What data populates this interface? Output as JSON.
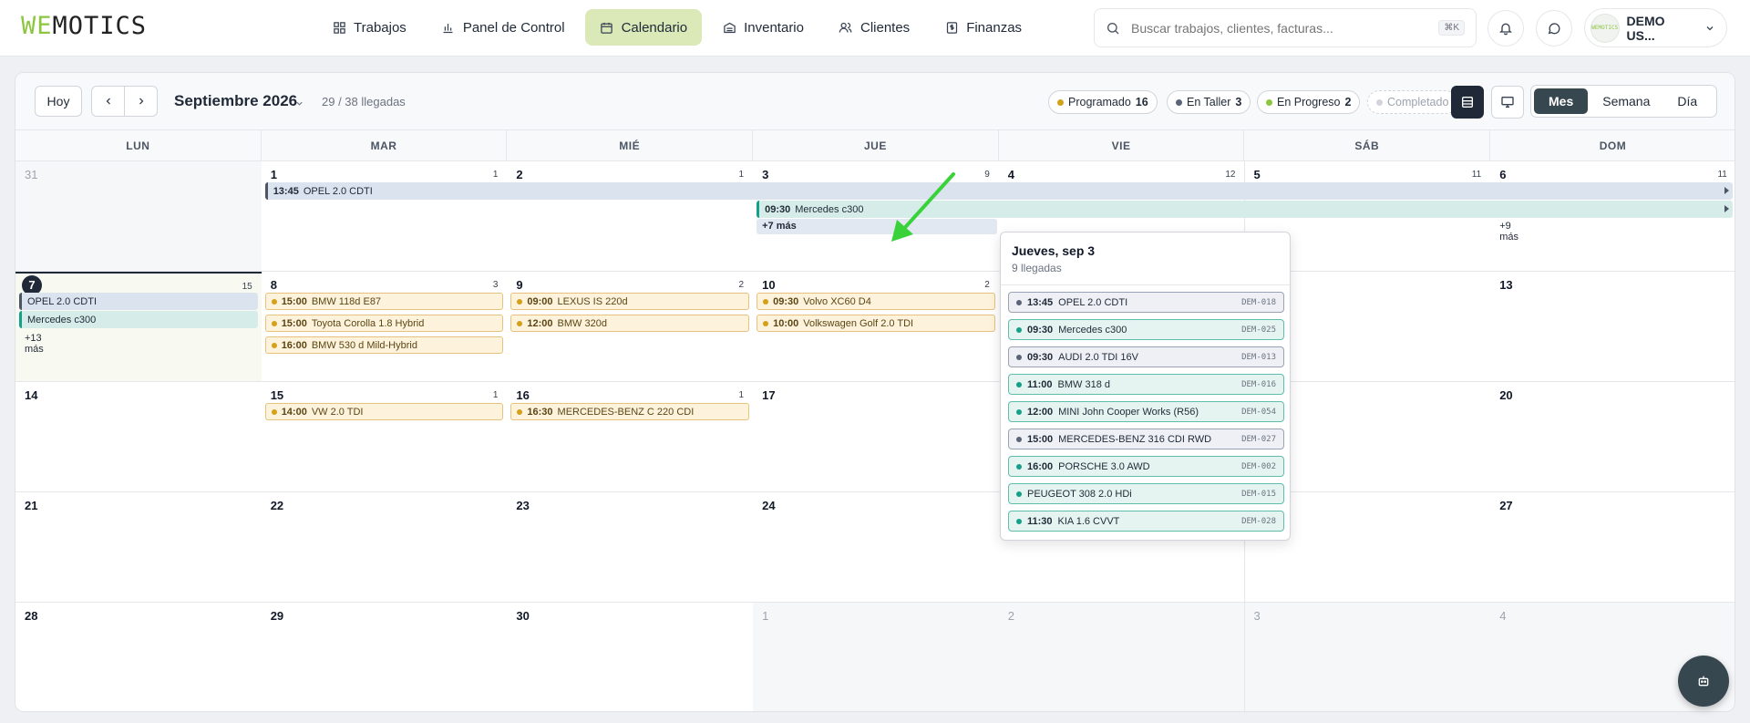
{
  "header": {
    "logo_accent": "WE",
    "logo_rest": "MOTICS",
    "nav": [
      {
        "label": "Trabajos",
        "icon": "grid-icon"
      },
      {
        "label": "Panel de Control",
        "icon": "chart-icon"
      },
      {
        "label": "Calendario",
        "icon": "calendar-icon",
        "active": true
      },
      {
        "label": "Inventario",
        "icon": "inventory-icon"
      },
      {
        "label": "Clientes",
        "icon": "users-icon"
      },
      {
        "label": "Finanzas",
        "icon": "dollar-icon"
      }
    ],
    "search_placeholder": "Buscar trabajos, clientes, facturas...",
    "search_shortcut": "⌘K",
    "user_name": "DEMO US...",
    "avatar_text": "WEMOTICS"
  },
  "toolbar": {
    "today": "Hoy",
    "month": "Septiembre 2026",
    "arrivals": "29 / 38 llegadas",
    "status": [
      {
        "label": "Programado",
        "count": "16",
        "color": "#d4a017"
      },
      {
        "label": "En Taller",
        "count": "3",
        "color": "#5b6478"
      },
      {
        "label": "En Progreso",
        "count": "2",
        "color": "#8cc63f"
      },
      {
        "label": "Completado",
        "count": "",
        "color": "#d1d5db"
      }
    ],
    "views": [
      "Mes",
      "Semana",
      "Día"
    ],
    "active_view": "Mes"
  },
  "weekdays": [
    "LUN",
    "MAR",
    "MIÉ",
    "JUE",
    "VIE",
    "SÁB",
    "DOM"
  ],
  "weeks": [
    [
      {
        "n": "31",
        "out": true
      },
      {
        "n": "1",
        "c": "1"
      },
      {
        "n": "2",
        "c": "1"
      },
      {
        "n": "3",
        "c": "9"
      },
      {
        "n": "4",
        "c": "12"
      },
      {
        "n": "5",
        "c": "11"
      },
      {
        "n": "6",
        "c": "11"
      }
    ],
    [
      {
        "n": "7",
        "c": "15",
        "today": true
      },
      {
        "n": "8",
        "c": "3"
      },
      {
        "n": "9",
        "c": "2"
      },
      {
        "n": "10",
        "c": "2"
      },
      {
        "n": "11"
      },
      {
        "n": "12"
      },
      {
        "n": "13"
      }
    ],
    [
      {
        "n": "14"
      },
      {
        "n": "15",
        "c": "1"
      },
      {
        "n": "16",
        "c": "1"
      },
      {
        "n": "17"
      },
      {
        "n": "18"
      },
      {
        "n": "19"
      },
      {
        "n": "20"
      }
    ],
    [
      {
        "n": "21"
      },
      {
        "n": "22"
      },
      {
        "n": "23"
      },
      {
        "n": "24"
      },
      {
        "n": "25"
      },
      {
        "n": "26"
      },
      {
        "n": "27"
      }
    ],
    [
      {
        "n": "28"
      },
      {
        "n": "29"
      },
      {
        "n": "30"
      },
      {
        "n": "1",
        "out": true
      },
      {
        "n": "2",
        "out": true
      },
      {
        "n": "3",
        "out": true
      },
      {
        "n": "4",
        "out": true
      }
    ]
  ],
  "span_events": [
    {
      "time": "13:45",
      "title": "OPEL 2.0 CDTI"
    },
    {
      "time": "09:30",
      "title": "Mercedes c300"
    }
  ],
  "week2_spans": [
    {
      "title": "OPEL 2.0 CDTI"
    },
    {
      "title": "Mercedes c300"
    }
  ],
  "more": {
    "thu": "+7 más",
    "sun": "+9 más",
    "mon7": "+13 más"
  },
  "events": {
    "d8": [
      {
        "time": "15:00",
        "title": "BMW 118d E87"
      },
      {
        "time": "15:00",
        "title": "Toyota Corolla 1.8 Hybrid"
      },
      {
        "time": "16:00",
        "title": "BMW 530 d Mild-Hybrid"
      }
    ],
    "d9": [
      {
        "time": "09:00",
        "title": "LEXUS IS 220d"
      },
      {
        "time": "12:00",
        "title": "BMW 320d"
      }
    ],
    "d10": [
      {
        "time": "09:30",
        "title": "Volvo XC60 D4"
      },
      {
        "time": "10:00",
        "title": "Volkswagen Golf 2.0 TDI"
      }
    ],
    "d15": [
      {
        "time": "14:00",
        "title": "VW 2.0 TDI"
      }
    ],
    "d16": [
      {
        "time": "16:30",
        "title": "MERCEDES-BENZ C 220 CDI"
      }
    ]
  },
  "popover": {
    "title": "Jueves, sep 3",
    "subtitle": "9 llegadas",
    "items": [
      {
        "time": "13:45",
        "title": "OPEL 2.0 CDTI",
        "code": "DEM-018",
        "kind": "g"
      },
      {
        "time": "09:30",
        "title": "Mercedes c300",
        "code": "DEM-025",
        "kind": "t"
      },
      {
        "time": "09:30",
        "title": "AUDI 2.0 TDI 16V",
        "code": "DEM-013",
        "kind": "g"
      },
      {
        "time": "11:00",
        "title": "BMW 318 d",
        "code": "DEM-016",
        "kind": "t"
      },
      {
        "time": "12:00",
        "title": "MINI John Cooper Works (R56)",
        "code": "DEM-054",
        "kind": "t"
      },
      {
        "time": "15:00",
        "title": "MERCEDES-BENZ 316 CDI RWD",
        "code": "DEM-027",
        "kind": "g"
      },
      {
        "time": "16:00",
        "title": "PORSCHE 3.0 AWD",
        "code": "DEM-002",
        "kind": "t"
      },
      {
        "time": "",
        "title": "PEUGEOT 308 2.0 HDi",
        "code": "DEM-015",
        "kind": "t"
      },
      {
        "time": "11:30",
        "title": "KIA 1.6 CVVT",
        "code": "DEM-028",
        "kind": "t"
      }
    ]
  }
}
